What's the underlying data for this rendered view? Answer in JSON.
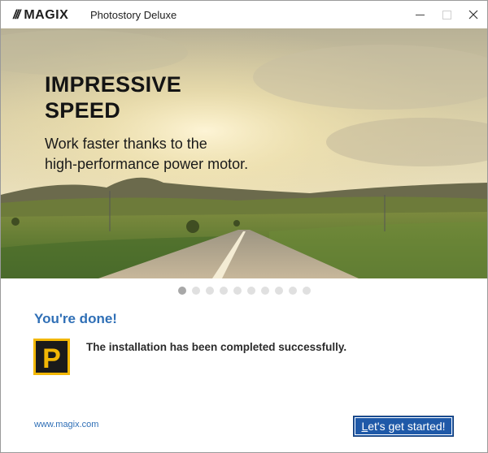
{
  "window": {
    "logo_slashes": "///",
    "logo_text": "MAGIX",
    "app_name": "Photostory Deluxe",
    "controls": [
      "minimize-icon",
      "maximize-icon",
      "close-icon"
    ]
  },
  "hero": {
    "title": "IMPRESSIVE\nSPEED",
    "subtitle": "Work faster thanks to the\nhigh-performance power motor."
  },
  "carousel": {
    "slide_count": 10,
    "active_index": 0
  },
  "completion": {
    "heading": "You're done!",
    "message": "The installation has been completed successfully.",
    "icon": "photostory-app-icon",
    "icon_letter": "P"
  },
  "footer": {
    "website": "www.magix.com",
    "start_button_accel": "L",
    "start_button_rest": "et's get started!"
  },
  "colors": {
    "accent": "#2f6fb6",
    "button": "#1f59a8",
    "icon_yellow": "#f2b705"
  }
}
